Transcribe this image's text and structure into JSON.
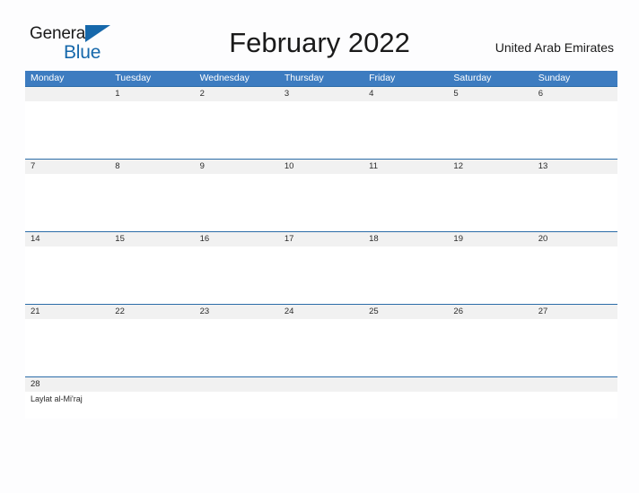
{
  "logo": {
    "word1": "General",
    "word2": "Blue",
    "flag_icon": "triangle-flag-icon",
    "color_dark": "#1a1a1a",
    "color_blue": "#1668ab"
  },
  "header": {
    "title": "February 2022",
    "country": "United Arab Emirates"
  },
  "theme": {
    "header_blue": "#3d7cc0",
    "rule_blue": "#2b6ca8",
    "date_strip": "#f1f1f1",
    "page_background": "#fdfdfe",
    "text": "#2b2b2b"
  },
  "calendar": {
    "weekdays": [
      "Monday",
      "Tuesday",
      "Wednesday",
      "Thursday",
      "Friday",
      "Saturday",
      "Sunday"
    ],
    "weeks": [
      {
        "days": [
          {
            "date": "",
            "events": []
          },
          {
            "date": "1",
            "events": []
          },
          {
            "date": "2",
            "events": []
          },
          {
            "date": "3",
            "events": []
          },
          {
            "date": "4",
            "events": []
          },
          {
            "date": "5",
            "events": []
          },
          {
            "date": "6",
            "events": []
          }
        ]
      },
      {
        "days": [
          {
            "date": "7",
            "events": []
          },
          {
            "date": "8",
            "events": []
          },
          {
            "date": "9",
            "events": []
          },
          {
            "date": "10",
            "events": []
          },
          {
            "date": "11",
            "events": []
          },
          {
            "date": "12",
            "events": []
          },
          {
            "date": "13",
            "events": []
          }
        ]
      },
      {
        "days": [
          {
            "date": "14",
            "events": []
          },
          {
            "date": "15",
            "events": []
          },
          {
            "date": "16",
            "events": []
          },
          {
            "date": "17",
            "events": []
          },
          {
            "date": "18",
            "events": []
          },
          {
            "date": "19",
            "events": []
          },
          {
            "date": "20",
            "events": []
          }
        ]
      },
      {
        "days": [
          {
            "date": "21",
            "events": []
          },
          {
            "date": "22",
            "events": []
          },
          {
            "date": "23",
            "events": []
          },
          {
            "date": "24",
            "events": []
          },
          {
            "date": "25",
            "events": []
          },
          {
            "date": "26",
            "events": []
          },
          {
            "date": "27",
            "events": []
          }
        ]
      },
      {
        "days": [
          {
            "date": "28",
            "events": [
              "Laylat al-Mi'raj"
            ]
          },
          {
            "date": "",
            "events": []
          },
          {
            "date": "",
            "events": []
          },
          {
            "date": "",
            "events": []
          },
          {
            "date": "",
            "events": []
          },
          {
            "date": "",
            "events": []
          },
          {
            "date": "",
            "events": []
          }
        ]
      }
    ]
  }
}
